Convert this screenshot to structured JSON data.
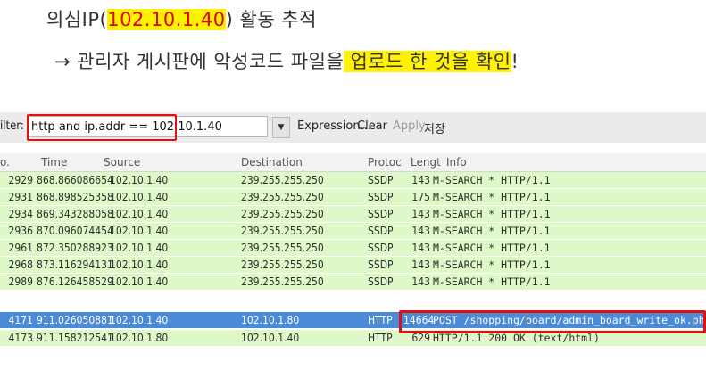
{
  "slide": {
    "title_prefix": "의심IP(",
    "title_ip": "102.10.1.40",
    "title_suffix": ") 활동 추적",
    "subtitle_plain": "→ 관리자 게시판에 악성코드 파일을",
    "subtitle_highlight_a": " 업로드 한 것을 확인",
    "subtitle_end": "!"
  },
  "toolbar": {
    "filter_label": "ilter:",
    "filter_value": "http and ip.addr == 102.10.1.40",
    "dropdown_glyph": "▼",
    "expression_label": "Expression...",
    "clear_label": "Clear",
    "apply_label": "Apply",
    "save_label": "저장"
  },
  "columns": {
    "no": "o.",
    "time": "Time",
    "source": "Source",
    "destination": "Destination",
    "protocol": "Protoc",
    "length": "Lengt",
    "info": "Info"
  },
  "packets": [
    {
      "no": "2929",
      "time": "868.866086654",
      "src": "102.10.1.40",
      "dst": "239.255.255.250",
      "proto": "SSDP",
      "len": "143",
      "info": "M-SEARCH * HTTP/1.1"
    },
    {
      "no": "2931",
      "time": "868.898525358",
      "src": "102.10.1.40",
      "dst": "239.255.255.250",
      "proto": "SSDP",
      "len": "175",
      "info": "M-SEARCH * HTTP/1.1"
    },
    {
      "no": "2934",
      "time": "869.343288058",
      "src": "102.10.1.40",
      "dst": "239.255.255.250",
      "proto": "SSDP",
      "len": "143",
      "info": "M-SEARCH * HTTP/1.1"
    },
    {
      "no": "2936",
      "time": "870.096074454",
      "src": "102.10.1.40",
      "dst": "239.255.255.250",
      "proto": "SSDP",
      "len": "143",
      "info": "M-SEARCH * HTTP/1.1"
    },
    {
      "no": "2961",
      "time": "872.350288923",
      "src": "102.10.1.40",
      "dst": "239.255.255.250",
      "proto": "SSDP",
      "len": "143",
      "info": "M-SEARCH * HTTP/1.1"
    },
    {
      "no": "2968",
      "time": "873.116294131",
      "src": "102.10.1.40",
      "dst": "239.255.255.250",
      "proto": "SSDP",
      "len": "143",
      "info": "M-SEARCH * HTTP/1.1"
    },
    {
      "no": "2989",
      "time": "876.126458529",
      "src": "102.10.1.40",
      "dst": "239.255.255.250",
      "proto": "SSDP",
      "len": "143",
      "info": "M-SEARCH * HTTP/1.1"
    },
    {
      "no": "4171",
      "time": "911.026050881",
      "src": "102.10.1.40",
      "dst": "102.10.1.80",
      "proto": "HTTP",
      "len": "14664",
      "info": "POST /shopping/board/admin_board_write_ok.php HT"
    },
    {
      "no": "4173",
      "time": "911.158212541",
      "src": "102.10.1.80",
      "dst": "102.10.1.40",
      "proto": "HTTP",
      "len": "629",
      "info": "HTTP/1.1 200 OK  (text/html)"
    }
  ],
  "colors": {
    "row_green": "#dff8c8",
    "selected_row": "#4a8ad6",
    "highlight_yellow": "#fff200",
    "annotation_red": "#e01010"
  }
}
